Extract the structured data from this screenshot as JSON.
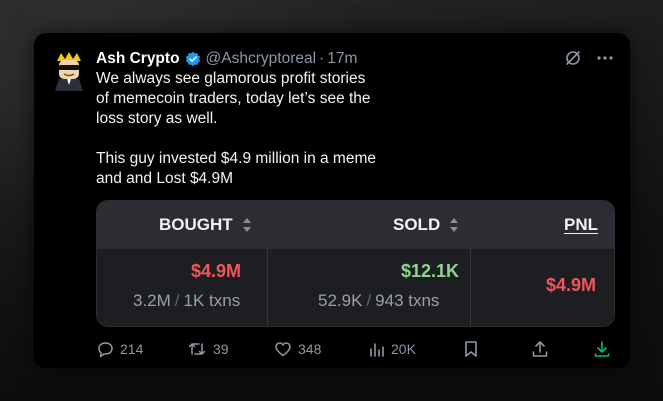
{
  "tweet": {
    "author_name": "Ash Crypto",
    "handle": "@Ashcryptoreal",
    "separator": "·",
    "time": "17m",
    "text_lines": [
      "We always see glamorous profit stories",
      "of memecoin traders, today let’s see the",
      "loss story as well."
    ],
    "text_lines_2": [
      "This guy invested $4.9 million in a meme",
      "and and Lost $4.9M"
    ]
  },
  "embed": {
    "columns": {
      "bought": "BOUGHT",
      "sold": "SOLD",
      "pnl": "PNL"
    },
    "bought": {
      "amount": "$4.9M",
      "volume": "3.2M",
      "slash": "/",
      "txns": "1K txns"
    },
    "sold": {
      "amount": "$12.1K",
      "volume": "52.9K",
      "slash": "/",
      "txns": "943 txns"
    },
    "pnl": {
      "amount": "$4.9M"
    }
  },
  "actions": {
    "replies": "214",
    "reposts": "39",
    "likes": "348",
    "views": "20K"
  },
  "icons": {
    "verified": "verified-badge-icon",
    "grok": "grok-icon",
    "more": "more-icon",
    "reply": "reply-icon",
    "repost": "repost-icon",
    "like": "like-icon",
    "views": "views-icon",
    "bookmark": "bookmark-icon",
    "share": "share-icon",
    "download": "download-icon"
  },
  "colors": {
    "loss": "#f0565c",
    "gain": "#8fd58c",
    "verified": "#1d9bf0",
    "download": "#00ba7c"
  }
}
